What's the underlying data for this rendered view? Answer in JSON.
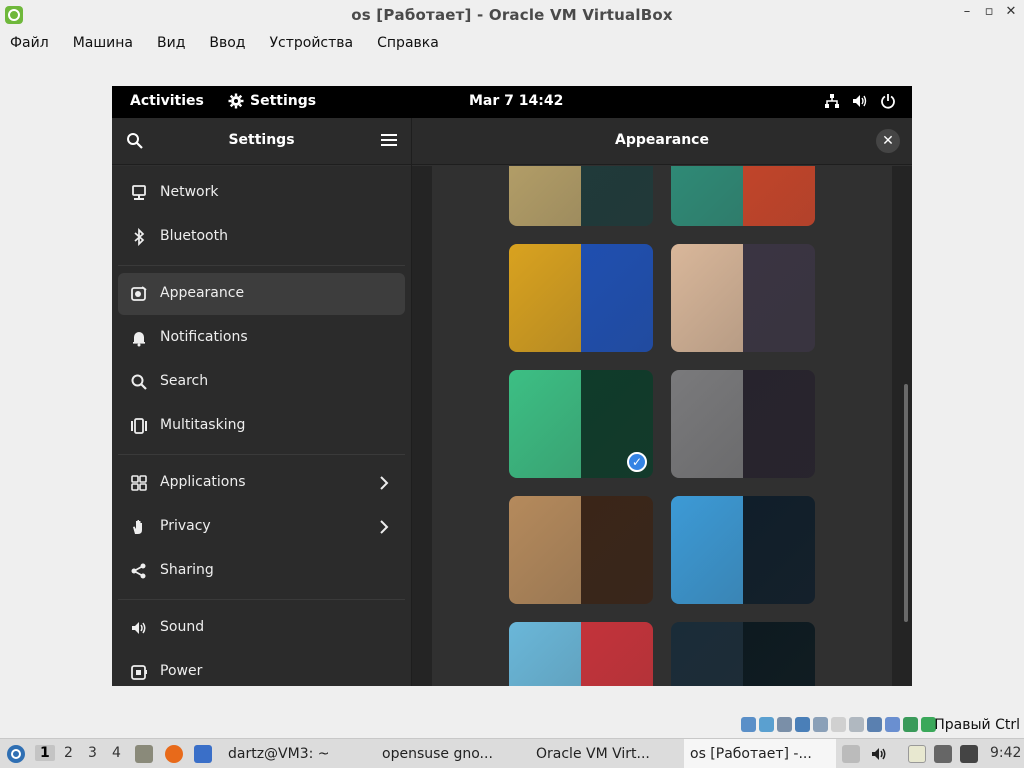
{
  "vbox": {
    "window_title": "os [Работает] - Oracle VM VirtualBox",
    "menu": [
      "Файл",
      "Машина",
      "Вид",
      "Ввод",
      "Устройства",
      "Справка"
    ],
    "host_key": "Правый Ctrl"
  },
  "gnome": {
    "activities": "Activities",
    "app_name": "Settings",
    "clock": "Mar 7  14:42"
  },
  "settings": {
    "sidebar_title": "Settings",
    "content_title": "Appearance",
    "close_glyph": "✕",
    "sidebar_items": [
      {
        "label": "Network",
        "icon": "network-icon"
      },
      {
        "label": "Bluetooth",
        "icon": "bluetooth-icon"
      },
      {
        "label": "Appearance",
        "icon": "appearance-icon",
        "active": true
      },
      {
        "label": "Notifications",
        "icon": "bell-icon"
      },
      {
        "label": "Search",
        "icon": "search-icon"
      },
      {
        "label": "Multitasking",
        "icon": "multitasking-icon"
      },
      {
        "label": "Applications",
        "icon": "apps-grid-icon",
        "has_chevron": true
      },
      {
        "label": "Privacy",
        "icon": "hand-icon",
        "has_chevron": true
      },
      {
        "label": "Sharing",
        "icon": "share-icon"
      },
      {
        "label": "Sound",
        "icon": "speaker-icon"
      },
      {
        "label": "Power",
        "icon": "power-icon"
      }
    ],
    "wallpapers": [
      {
        "light": "#b9a36a",
        "dark": "#1f3a3a",
        "selected": false
      },
      {
        "light": "#2f8f7a",
        "dark": "#c6452a",
        "selected": false
      },
      {
        "light": "#d9a21f",
        "dark": "#1f4fb0",
        "selected": false
      },
      {
        "light": "#d9b79a",
        "dark": "#3a3442",
        "selected": false
      },
      {
        "light": "#3cbf84",
        "dark": "#0f3b2a",
        "selected": true
      },
      {
        "light": "#7a7a7c",
        "dark": "#27232d",
        "selected": false
      },
      {
        "light": "#b58a5c",
        "dark": "#3a2518",
        "selected": false
      },
      {
        "light": "#3c9ad6",
        "dark": "#101e2a",
        "selected": false
      },
      {
        "light": "#6ab7d9",
        "dark": "#c3333a",
        "selected": false
      },
      {
        "light": "#1a2c38",
        "dark": "#0d1a20",
        "selected": false
      }
    ],
    "selected_glyph": "✓"
  },
  "taskbar": {
    "workspaces": [
      "1",
      "2",
      "3",
      "4"
    ],
    "tasks": [
      {
        "label": "dartz@VM3: ~",
        "active": false
      },
      {
        "label": "opensuse gno...",
        "active": false
      },
      {
        "label": "Oracle VM Virt...",
        "active": false
      },
      {
        "label": "os [Работает] -...",
        "active": true
      }
    ],
    "time": "9:42"
  },
  "colors": {
    "accent": "#3584e4",
    "sidebar_bg": "#2b2b2b",
    "content_bg": "#242424"
  }
}
